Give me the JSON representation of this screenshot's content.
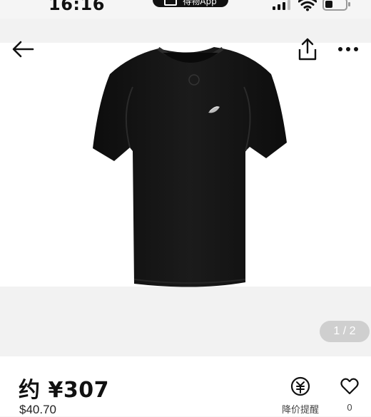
{
  "status_bar": {
    "time": "16:16",
    "pill_text": "得物App"
  },
  "product": {
    "image_alt": "black-tshirt-product-image",
    "page_indicator": "1 / 2"
  },
  "price": {
    "main": "约 ¥307",
    "secondary": "$40.70"
  },
  "actions": {
    "price_alert_label": "降价提醒",
    "favorite_count": "0"
  },
  "colors": {
    "background": "#f5f5f5",
    "shirt": "#141414",
    "indicator_bg": "#cfcfcf"
  },
  "icons": {
    "back": "arrow-left-icon",
    "share": "share-icon",
    "more": "more-horizontal-icon",
    "price_alert": "price-alert-icon",
    "favorite": "heart-icon"
  }
}
